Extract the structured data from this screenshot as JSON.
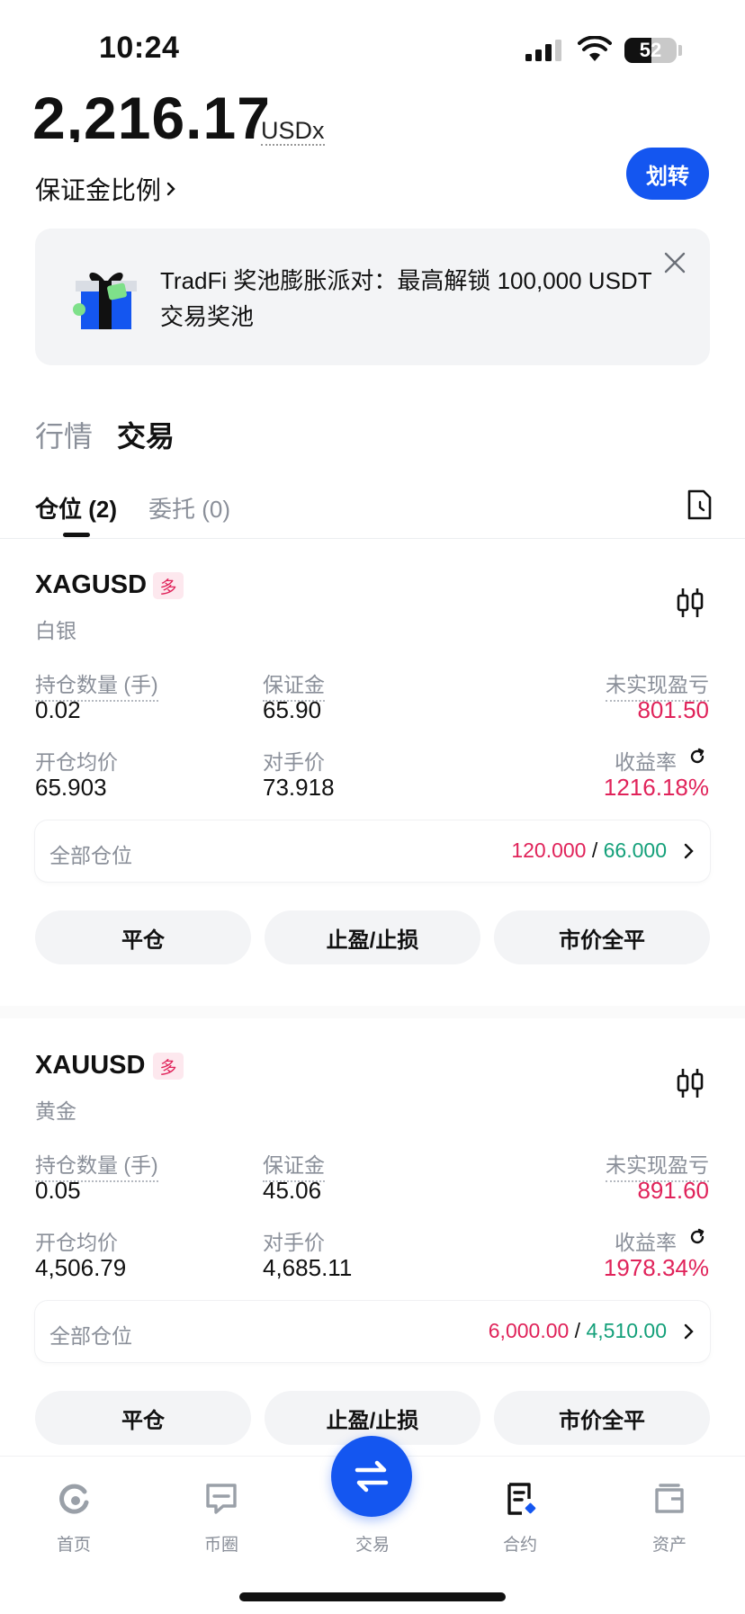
{
  "status_bar": {
    "time": "10:24",
    "battery": "52",
    "battery_level": 0.52
  },
  "account": {
    "balance": "2,216.17",
    "currency": "USDx",
    "margin_ratio_label": "保证金比例",
    "transfer_label": "划转"
  },
  "banner": {
    "text": "TradFi 奖池膨胀派对：最高解锁 100,000 USDT 交易奖池",
    "icon": "gift-box-icon"
  },
  "segments": {
    "market": "行情",
    "trade": "交易"
  },
  "tabs": {
    "positions": "仓位 (2)",
    "orders": "委托 (0)"
  },
  "labels": {
    "qty": "持仓数量 (手)",
    "margin": "保证金",
    "upnl": "未实现盈亏",
    "entry": "开仓均价",
    "counter": "对手价",
    "roi": "收益率",
    "all_positions": "全部仓位",
    "close": "平仓",
    "tpsl": "止盈/止损",
    "market_close": "市价全平"
  },
  "positions": [
    {
      "symbol": "XAGUSD",
      "side": "多",
      "name": "白银",
      "qty": "0.02",
      "margin": "65.90",
      "upnl": "801.50",
      "entry": "65.903",
      "counter": "73.918",
      "roi": "1216.18%",
      "all_long": "120.000",
      "all_short": "66.000"
    },
    {
      "symbol": "XAUUSD",
      "side": "多",
      "name": "黄金",
      "qty": "0.05",
      "margin": "45.06",
      "upnl": "891.60",
      "entry": "4,506.79",
      "counter": "4,685.11",
      "roi": "1978.34%",
      "all_long": "6,000.00",
      "all_short": "4,510.00"
    }
  ],
  "nav": {
    "home": "首页",
    "community": "币圈",
    "trade": "交易",
    "futures": "合约",
    "assets": "资产"
  },
  "colors": {
    "accent": "#1456f0",
    "red": "#e0235a",
    "green": "#14a07a"
  }
}
